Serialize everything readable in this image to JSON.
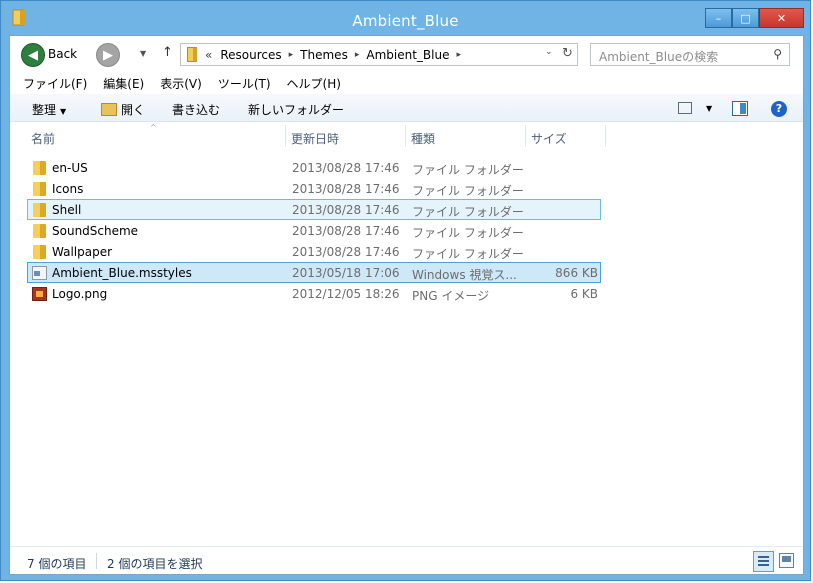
{
  "window": {
    "title": "Ambient_Blue",
    "controls": {
      "minimize": "–",
      "maximize": "□",
      "close": "✕"
    }
  },
  "nav": {
    "back_label": "Back",
    "back_icon": "arrow-left-icon",
    "forward_icon": "arrow-right-icon",
    "up_symbol": "↑",
    "history_symbol": "▼",
    "breadcrumbs": [
      "Resources",
      "Themes",
      "Ambient_Blue"
    ],
    "overflow_symbol": "«",
    "chevron": "▸",
    "dropdown_symbol": "⌄",
    "refresh_symbol": "↻"
  },
  "search": {
    "placeholder": "Ambient_Blueの検索",
    "icon": "⚲"
  },
  "menu": {
    "items": [
      "ファイル(F)",
      "編集(E)",
      "表示(V)",
      "ツール(T)",
      "ヘルプ(H)"
    ]
  },
  "toolbar": {
    "organize": "整理",
    "open": "開く",
    "burn": "書き込む",
    "new_folder": "新しいフォルダー",
    "dropdown_symbol": "▼",
    "help": "?"
  },
  "columns": {
    "name": "名前",
    "date": "更新日時",
    "type": "種類",
    "size": "サイズ",
    "sort_symbol": "^"
  },
  "files": [
    {
      "name": "en-US",
      "date": "2013/08/28 17:46",
      "type": "ファイル フォルダー",
      "size": "",
      "icon": "folder-icon",
      "state": ""
    },
    {
      "name": "Icons",
      "date": "2013/08/28 17:46",
      "type": "ファイル フォルダー",
      "size": "",
      "icon": "folder-icon",
      "state": ""
    },
    {
      "name": "Shell",
      "date": "2013/08/28 17:46",
      "type": "ファイル フォルダー",
      "size": "",
      "icon": "folder-icon",
      "state": "hover"
    },
    {
      "name": "SoundScheme",
      "date": "2013/08/28 17:46",
      "type": "ファイル フォルダー",
      "size": "",
      "icon": "folder-icon",
      "state": ""
    },
    {
      "name": "Wallpaper",
      "date": "2013/08/28 17:46",
      "type": "ファイル フォルダー",
      "size": "",
      "icon": "folder-icon",
      "state": ""
    },
    {
      "name": "Ambient_Blue.msstyles",
      "date": "2013/05/18 17:06",
      "type": "Windows 視覚ス...",
      "size": "866 KB",
      "icon": "msstyles-file-icon",
      "state": "sel"
    },
    {
      "name": "Logo.png",
      "date": "2012/12/05 18:26",
      "type": "PNG イメージ",
      "size": "6 KB",
      "icon": "png-file-icon",
      "state": ""
    }
  ],
  "status": {
    "item_count": "7 個の項目",
    "selected_count": "2 個の項目を選択"
  }
}
